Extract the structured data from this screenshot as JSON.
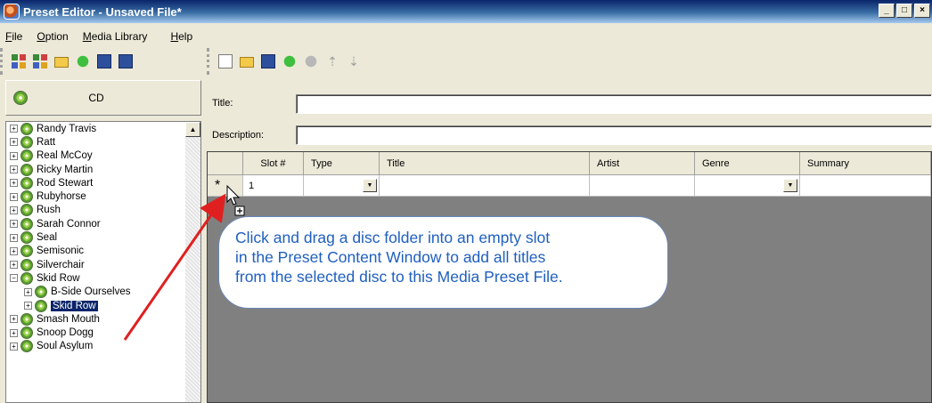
{
  "window": {
    "title": "Preset Editor - Unsaved File*",
    "btn_min": "_",
    "btn_max": "□",
    "btn_close": "×"
  },
  "menu": [
    "File",
    "Option",
    "Media Library",
    "Help"
  ],
  "left_pane": {
    "header_label": "CD",
    "tree": [
      {
        "label": "Randy Travis",
        "expander": "+",
        "level": 1
      },
      {
        "label": "Ratt",
        "expander": "+",
        "level": 1
      },
      {
        "label": "Real McCoy",
        "expander": "+",
        "level": 1
      },
      {
        "label": "Ricky Martin",
        "expander": "+",
        "level": 1
      },
      {
        "label": "Rod Stewart",
        "expander": "+",
        "level": 1
      },
      {
        "label": "Rubyhorse",
        "expander": "+",
        "level": 1
      },
      {
        "label": "Rush",
        "expander": "+",
        "level": 1
      },
      {
        "label": "Sarah Connor",
        "expander": "+",
        "level": 1
      },
      {
        "label": "Seal",
        "expander": "+",
        "level": 1
      },
      {
        "label": "Semisonic",
        "expander": "+",
        "level": 1
      },
      {
        "label": "Silverchair",
        "expander": "+",
        "level": 1
      },
      {
        "label": "Skid Row",
        "expander": "−",
        "level": 1
      },
      {
        "label": "B-Side Ourselves",
        "expander": "+",
        "level": 2
      },
      {
        "label": "Skid Row",
        "expander": "+",
        "level": 2,
        "selected": true
      },
      {
        "label": "Smash Mouth",
        "expander": "+",
        "level": 1
      },
      {
        "label": "Snoop Dogg",
        "expander": "+",
        "level": 1
      },
      {
        "label": "Soul Asylum",
        "expander": "+",
        "level": 1
      }
    ]
  },
  "form": {
    "title_label": "Title:",
    "title_value": "",
    "description_label": "Description:",
    "description_value": ""
  },
  "grid": {
    "columns": [
      "",
      "Slot #",
      "Type",
      "Title",
      "Artist",
      "Genre",
      "Summary"
    ],
    "rows": [
      {
        "indicator": "*",
        "slot": "1",
        "type": "",
        "title": "",
        "artist": "",
        "genre": "",
        "summary": ""
      }
    ]
  },
  "callout": {
    "lines": [
      "Click and drag a disc folder into an empty slot",
      "in the Preset Content Window to add all titles",
      "from the selected disc to this Media Preset File."
    ]
  },
  "colors": {
    "callout_text": "#1f5fbf",
    "arrow": "#e02020",
    "selection": "#0a246a"
  }
}
